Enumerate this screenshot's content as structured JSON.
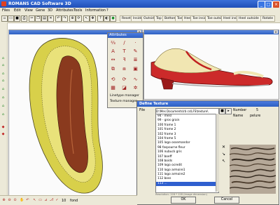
{
  "app": {
    "title": "ROMANS CAD Software 3D"
  },
  "menu": [
    "Files",
    "Edit",
    "View",
    "Gene",
    "3D",
    "Attributes",
    "Tools",
    "Information",
    "?"
  ],
  "view_buttons": [
    "Reset",
    "Inside",
    "Outside",
    "Top",
    "Bottom",
    "Toe",
    "Heel",
    "Toe inside",
    "Toe outside",
    "Heel inside",
    "Heel outside",
    "Rotate"
  ],
  "attributes_panel": {
    "title": "Attributes",
    "menu_items": [
      "Linetype manager",
      "Texture manager"
    ]
  },
  "texture_dialog": {
    "title": "Define Texture",
    "file_label": "File",
    "file_path": "D:\\Mes Documents\\rb cs\\LFS\\texture\\",
    "number_label": "Number",
    "number_value": "5",
    "name_label": "Name",
    "name_value": "pelure",
    "items": [
      "94 - mesl",
      "99 - gros grain",
      "100 frame 1",
      "101 frame 2",
      "102 frame 3",
      "104 frame 5",
      "105 logo ossemandor",
      "98 faspourne fleur",
      "106 nubuck gris",
      "107 boeff",
      "108 boids",
      "109 logo ocredit",
      "110 logo armoire1",
      "111 logo armoire2",
      "112 boss",
      "113 ..."
    ],
    "selected_index": 15,
    "hint": "Resolution: 128 * 128 (Image dimension)",
    "ok_label": "OK",
    "cancel_label": "Cancel"
  },
  "status": {
    "value": "10",
    "unit": "fond"
  }
}
